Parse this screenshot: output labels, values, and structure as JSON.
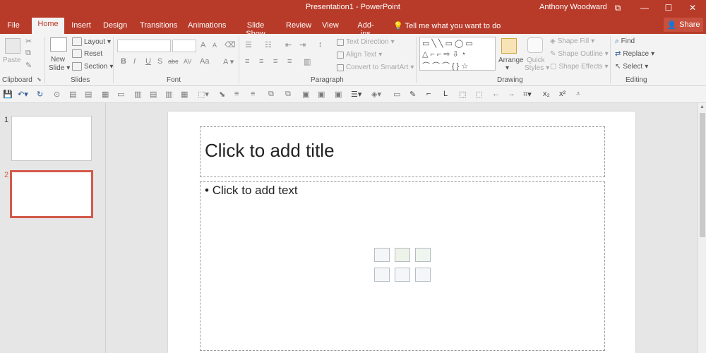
{
  "window": {
    "title": "Presentation1 - PowerPoint",
    "user": "Anthony Woodward",
    "controls": [
      "⧉",
      "—",
      "☐",
      "✕"
    ]
  },
  "tabs": [
    "File",
    "Home",
    "Insert",
    "Design",
    "Transitions",
    "Animations",
    "Slide Show",
    "Review",
    "View",
    "Add-ins"
  ],
  "active_tab": "Home",
  "tell_me": "Tell me what you want to do",
  "share": "Share",
  "ribbon": {
    "clipboard": {
      "paste": "Paste",
      "label": "Clipboard"
    },
    "slides": {
      "new_slide_1": "New",
      "new_slide_2": "Slide",
      "layout": "Layout",
      "reset": "Reset",
      "section": "Section",
      "label": "Slides"
    },
    "font": {
      "label": "Font",
      "bold": "B",
      "italic": "I",
      "underline": "U",
      "strike": "S",
      "abc": "abc",
      "av": "AV",
      "aa": "Aa",
      "grow": "A",
      "shrink": "A"
    },
    "paragraph": {
      "label": "Paragraph",
      "text_direction": "Text Direction",
      "align_text": "Align Text",
      "smartart": "Convert to SmartArt"
    },
    "drawing": {
      "label": "Drawing",
      "arrange": "Arrange",
      "quick_1": "Quick",
      "quick_2": "Styles",
      "shape_fill": "Shape Fill",
      "shape_outline": "Shape Outline",
      "shape_effects": "Shape Effects"
    },
    "editing": {
      "label": "Editing",
      "find": "Find",
      "replace": "Replace",
      "select": "Select"
    }
  },
  "thumbnails": [
    {
      "num": "1",
      "selected": false
    },
    {
      "num": "2",
      "selected": true
    }
  ],
  "slide": {
    "title_placeholder": "Click to add title",
    "body_placeholder": "Click to add text",
    "bullet": "•"
  },
  "colors": {
    "brand": "#b83b2a",
    "selection": "#d35a4a"
  }
}
